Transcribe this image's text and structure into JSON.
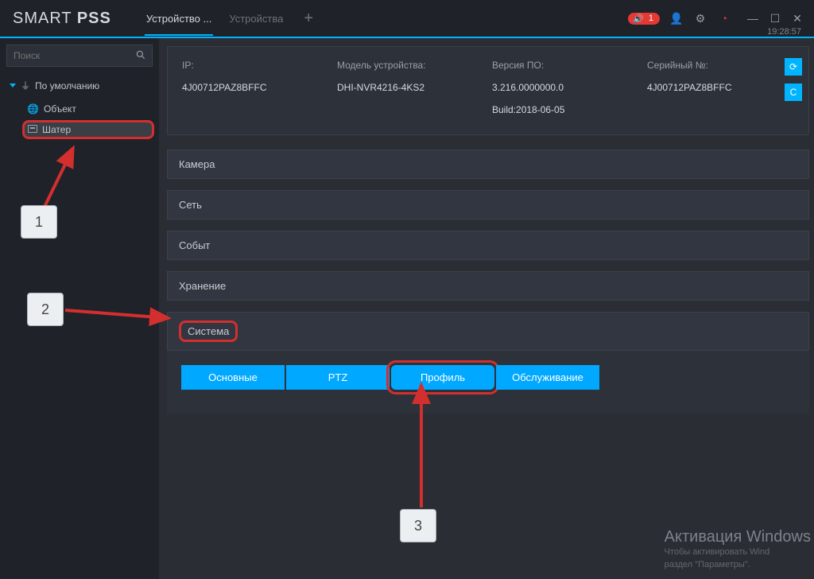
{
  "header": {
    "logo_light": "SMART",
    "logo_bold": "PSS",
    "tabs": [
      {
        "label": "Устройство ...",
        "active": true
      },
      {
        "label": "Устройства",
        "active": false
      }
    ],
    "alert_count": "1",
    "clock": "19:28:57"
  },
  "search": {
    "placeholder": "Поиск"
  },
  "tree": {
    "root_label": "По умолчанию",
    "object_label": "Объект",
    "shater_label": "Шатер"
  },
  "device_info": {
    "ip_label": "IP:",
    "ip": "4J00712PAZ8BFFC",
    "model_label": "Модель устройства:",
    "model": "DHI-NVR4216-4KS2",
    "version_label": "Версия ПО:",
    "version": "3.216.0000000.0",
    "build": "Build:2018-06-05",
    "serial_label": "Серийный №:",
    "serial": "4J00712PAZ8BFFC"
  },
  "sections": {
    "camera": "Камера",
    "network": "Сеть",
    "event": "Событ",
    "storage": "Хранение",
    "system": "Система"
  },
  "buttons": {
    "basic": "Основные",
    "ptz": "PTZ",
    "profile": "Профиль",
    "maintenance": "Обслуживание"
  },
  "callouts": {
    "one": "1",
    "two": "2",
    "three": "3"
  },
  "watermark": {
    "title": "Активация Windows",
    "line1": "Чтобы активировать Wind",
    "line2": "раздел \"Параметры\"."
  }
}
